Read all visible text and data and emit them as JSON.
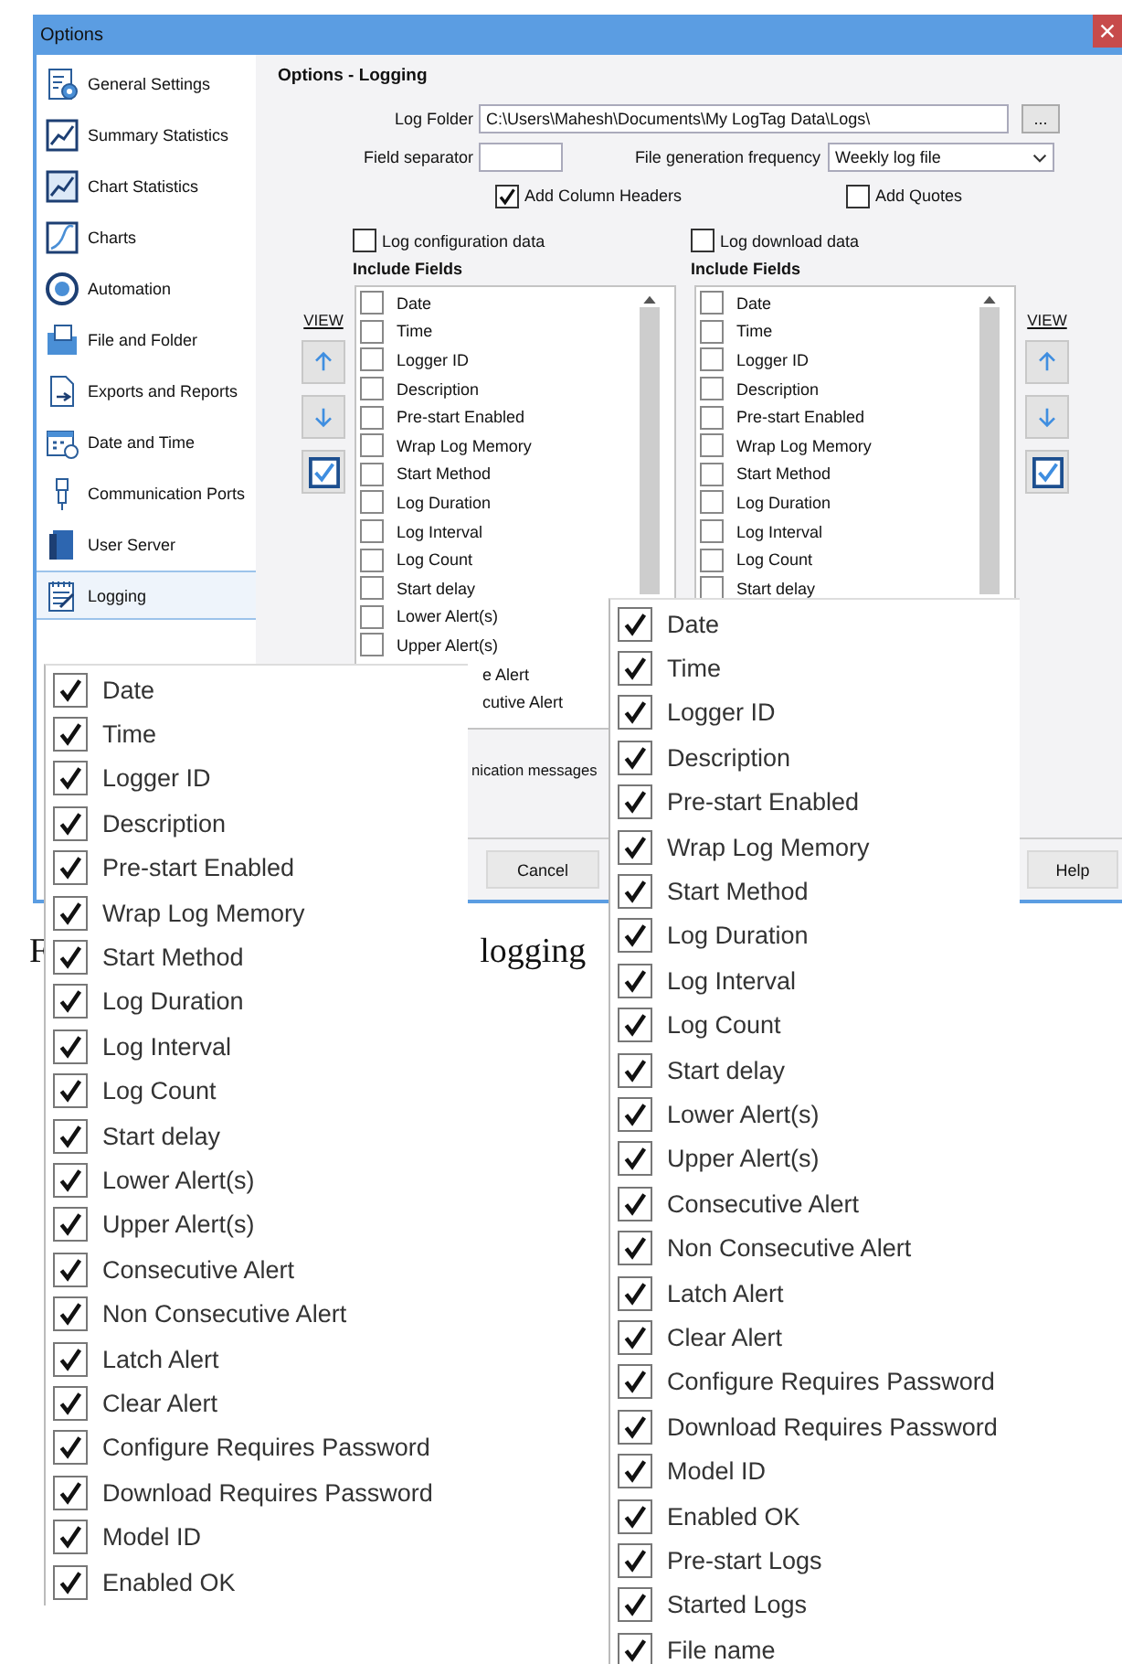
{
  "window": {
    "title": "Options"
  },
  "sidebar": {
    "items": [
      {
        "label": "General Settings",
        "selected": false
      },
      {
        "label": "Summary Statistics",
        "selected": false
      },
      {
        "label": "Chart Statistics",
        "selected": false
      },
      {
        "label": "Charts",
        "selected": false
      },
      {
        "label": "Automation",
        "selected": false
      },
      {
        "label": "File and Folder",
        "selected": false
      },
      {
        "label": "Exports and Reports",
        "selected": false
      },
      {
        "label": "Date and Time",
        "selected": false
      },
      {
        "label": "Communication Ports",
        "selected": false
      },
      {
        "label": "User Server",
        "selected": false
      },
      {
        "label": "Logging",
        "selected": true
      }
    ]
  },
  "panel": {
    "title": "Options - Logging",
    "log_folder": {
      "label": "Log Folder",
      "value": "C:\\Users\\Mahesh\\Documents\\My LogTag Data\\Logs\\",
      "browse_button": "..."
    },
    "field_separator": {
      "label": "Field separator"
    },
    "file_generation_frequency": {
      "label": "File generation frequency",
      "value": "Weekly log file"
    },
    "options": [
      {
        "label": "Add Column Headers",
        "checked": true
      },
      {
        "label": "Add Quotes",
        "checked": false
      }
    ],
    "lists": [
      {
        "toggle": {
          "label": "Log configuration data",
          "checked": false
        },
        "heading": "Include Fields",
        "view_link": "VIEW",
        "items": [
          {
            "kind": "full",
            "label": "Date",
            "checked": false
          },
          {
            "kind": "full",
            "label": "Time",
            "checked": false
          },
          {
            "kind": "full",
            "label": "Logger ID",
            "checked": false
          },
          {
            "kind": "full",
            "label": "Description",
            "checked": false
          },
          {
            "kind": "full",
            "label": "Pre-start Enabled",
            "checked": false
          },
          {
            "kind": "full",
            "label": "Wrap Log Memory",
            "checked": false
          },
          {
            "kind": "full",
            "label": "Start Method",
            "checked": false
          },
          {
            "kind": "full",
            "label": "Log Duration",
            "checked": false
          },
          {
            "kind": "full",
            "label": "Log Interval",
            "checked": false
          },
          {
            "kind": "full",
            "label": "Log Count",
            "checked": false
          },
          {
            "kind": "full",
            "label": "Start delay",
            "checked": false
          },
          {
            "kind": "full",
            "label": "Lower Alert(s)",
            "checked": false
          },
          {
            "kind": "full",
            "label": "Upper Alert(s)",
            "checked": false
          },
          {
            "kind": "fragment",
            "label": "e Alert"
          },
          {
            "kind": "fragment",
            "label": "cutive Alert"
          }
        ]
      },
      {
        "toggle": {
          "label": "Log download data",
          "checked": false
        },
        "heading": "Include Fields",
        "view_link": "VIEW",
        "items": [
          {
            "kind": "full",
            "label": "Date",
            "checked": false
          },
          {
            "kind": "full",
            "label": "Time",
            "checked": false
          },
          {
            "kind": "full",
            "label": "Logger ID",
            "checked": false
          },
          {
            "kind": "full",
            "label": "Description",
            "checked": false
          },
          {
            "kind": "full",
            "label": "Pre-start Enabled",
            "checked": false
          },
          {
            "kind": "full",
            "label": "Wrap Log Memory",
            "checked": false
          },
          {
            "kind": "full",
            "label": "Start Method",
            "checked": false
          },
          {
            "kind": "full",
            "label": "Log Duration",
            "checked": false
          },
          {
            "kind": "full",
            "label": "Log Interval",
            "checked": false
          },
          {
            "kind": "full",
            "label": "Log Count",
            "checked": false
          },
          {
            "kind": "full",
            "label": "Start delay",
            "checked": false
          }
        ]
      }
    ],
    "communication_fragment": "nication messages",
    "buttons": [
      {
        "label": "Cancel"
      },
      {
        "label": "Help"
      }
    ]
  },
  "caption": [
    "F",
    "logging"
  ],
  "zoom_insets": [
    {
      "items": [
        {
          "label": "Date",
          "checked": true
        },
        {
          "label": "Time",
          "checked": true
        },
        {
          "label": "Logger ID",
          "checked": true
        },
        {
          "label": "Description",
          "checked": true
        },
        {
          "label": "Pre-start Enabled",
          "checked": true
        },
        {
          "label": "Wrap Log Memory",
          "checked": true
        },
        {
          "label": "Start Method",
          "checked": true
        },
        {
          "label": "Log Duration",
          "checked": true
        },
        {
          "label": "Log Interval",
          "checked": true
        },
        {
          "label": "Log Count",
          "checked": true
        },
        {
          "label": "Start delay",
          "checked": true
        },
        {
          "label": "Lower Alert(s)",
          "checked": true
        },
        {
          "label": "Upper Alert(s)",
          "checked": true
        },
        {
          "label": "Consecutive Alert",
          "checked": true
        },
        {
          "label": "Non Consecutive Alert",
          "checked": true
        },
        {
          "label": "Latch Alert",
          "checked": true
        },
        {
          "label": "Clear Alert",
          "checked": true
        },
        {
          "label": "Configure Requires Password",
          "checked": true
        },
        {
          "label": "Download Requires Password",
          "checked": true
        },
        {
          "label": "Model ID",
          "checked": true
        },
        {
          "label": "Enabled OK",
          "checked": true
        }
      ]
    },
    {
      "items": [
        {
          "label": "Date",
          "checked": true
        },
        {
          "label": "Time",
          "checked": true
        },
        {
          "label": "Logger ID",
          "checked": true
        },
        {
          "label": "Description",
          "checked": true
        },
        {
          "label": "Pre-start Enabled",
          "checked": true
        },
        {
          "label": "Wrap Log Memory",
          "checked": true
        },
        {
          "label": "Start Method",
          "checked": true
        },
        {
          "label": "Log Duration",
          "checked": true
        },
        {
          "label": "Log Interval",
          "checked": true
        },
        {
          "label": "Log Count",
          "checked": true
        },
        {
          "label": "Start delay",
          "checked": true
        },
        {
          "label": "Lower Alert(s)",
          "checked": true
        },
        {
          "label": "Upper Alert(s)",
          "checked": true
        },
        {
          "label": "Consecutive Alert",
          "checked": true
        },
        {
          "label": "Non Consecutive Alert",
          "checked": true
        },
        {
          "label": "Latch Alert",
          "checked": true
        },
        {
          "label": "Clear Alert",
          "checked": true
        },
        {
          "label": "Configure Requires Password",
          "checked": true
        },
        {
          "label": "Download Requires Password",
          "checked": true
        },
        {
          "label": "Model ID",
          "checked": true
        },
        {
          "label": "Enabled OK",
          "checked": true
        },
        {
          "label": "Pre-start Logs",
          "checked": true
        },
        {
          "label": "Started Logs",
          "checked": true
        },
        {
          "label": "File name",
          "checked": true
        }
      ]
    }
  ]
}
